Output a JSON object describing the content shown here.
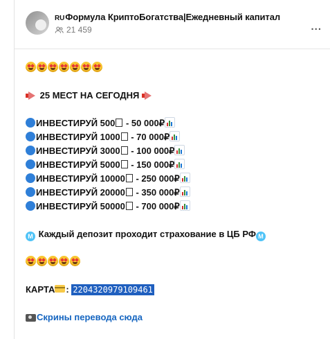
{
  "channel": {
    "flag": "RU",
    "title": "Формула КриптоБогатства|Ежедневный капитал",
    "subscribers": "21 459",
    "menu_label": "..."
  },
  "post": {
    "header_line": "25 МЕСТ НА СЕГОДНЯ",
    "offers": [
      "ИНВЕСТИРУЙ 500",
      " - 50 000₽",
      "ИНВЕСТИРУЙ 1000",
      " - 70 000₽",
      "ИНВЕСТИРУЙ 3000",
      " - 100 000₽",
      "ИНВЕСТИРУЙ 5000",
      " - 150 000₽",
      "ИНВЕСТИРУЙ 10000",
      " - 250 000₽",
      "ИНВЕСТИРУЙ 20000",
      " - 350 000₽",
      "ИНВЕСТИРУЙ 50000",
      " - 700 000₽"
    ],
    "insurance": "Каждый депозит проходит страхование в ЦБ РФ",
    "card_label": "КАРТА",
    "card_colon": ":",
    "card_number": "2204320979109461",
    "screens_link": "Скрины перевода сюда"
  },
  "colors": {
    "accent": "#1f5fbf",
    "link": "#1565c0"
  },
  "icons": [
    "star-eyes-face-icon",
    "megaphone-icon",
    "blue-circle-icon",
    "chart-icon",
    "m-circle-icon",
    "credit-card-icon",
    "camera-icon"
  ]
}
